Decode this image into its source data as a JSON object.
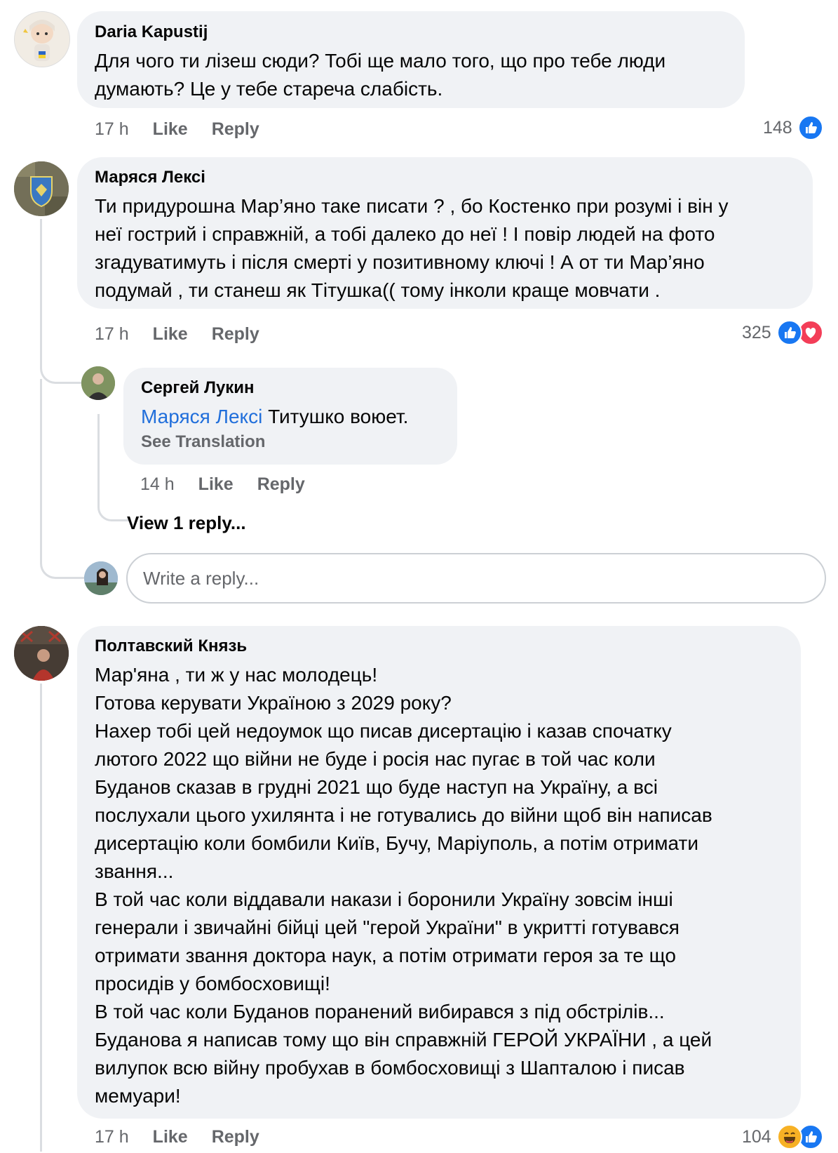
{
  "comments": [
    {
      "author": "Daria Kapustij",
      "text": "Для чого ти лізеш сюди? Тобі ще мало того, що про тебе люди\nдумають?  Це у тебе стареча слабість.",
      "time": "17 h",
      "like_label": "Like",
      "reply_label": "Reply",
      "reaction_count": "148",
      "reactions": [
        "like-icon"
      ]
    },
    {
      "author": "Маряся Лексі",
      "text": "Ти придурошна Мар’яно таке писати ? , бо Костенко при розумі і він у\nнеї гострий і справжній, а тобі далеко до неї ! І повір людей на фото\nзгадуватимуть і після смерті у позитивному ключі ! А от ти Мар’яно\nподумай , ти станеш як Тітушка(( тому інколи краще мовчати .",
      "time": "17 h",
      "like_label": "Like",
      "reply_label": "Reply",
      "reaction_count": "325",
      "reactions": [
        "like-icon",
        "love-icon"
      ],
      "replies": [
        {
          "author": "Сергей Лукин",
          "mention": "Маряся Лексі",
          "text": " Титушко воюет.",
          "see_translation": "See Translation",
          "time": "14 h",
          "like_label": "Like",
          "reply_label": "Reply"
        }
      ],
      "view_replies": "View 1 reply...",
      "write_reply_placeholder": "Write a reply..."
    },
    {
      "author": "Полтавский Князь",
      "text": "Мар'яна , ти ж у нас молодець!\nГотова керувати Україною з 2029 року?\nНахер тобі цей недоумок що писав дисертацію і казав спочатку\nлютого 2022  що війни не буде і росія нас пугає в той час коли\nБуданов сказав в грудні 2021 що буде наступ на Україну, а всі\nпослухали цього ухилянта і не готувались до війни щоб він написав\nдисертацію коли бомбили Київ, Бучу, Маріуполь, а потім отримати\nзвання...\nВ той час коли віддавали накази і боронили Україну зовсім інші\nгенерали і звичайні бійці  цей \"герой України\" в укритті готувався\nотримати звання  доктора наук, а потім отримати героя за те що\nпросидів у бомбосховищі!\nВ той час коли Буданов поранений вибирався   з під обстрілів...\n Буданова  я написав тому що  він справжній ГЕРОЙ УКРАЇНИ , а цей\nвилупок всю війну пробухав в бомбосховищі з Шапталою і писав\nмемуари!",
      "time": "17 h",
      "like_label": "Like",
      "reply_label": "Reply",
      "reaction_count": "104",
      "reactions": [
        "haha-icon",
        "like-icon"
      ]
    }
  ]
}
